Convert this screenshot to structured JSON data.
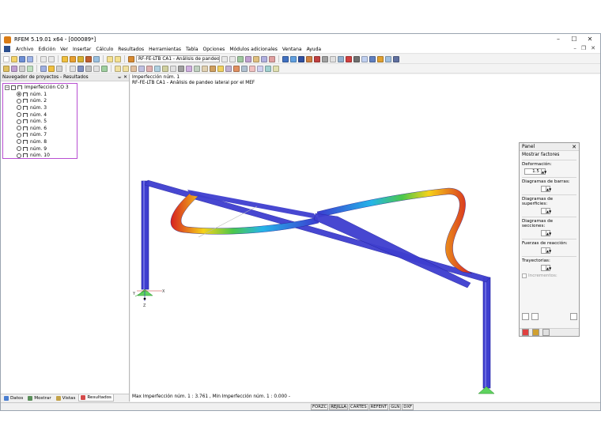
{
  "window": {
    "title": "RFEM 5.19.01 x64 - [000089*]"
  },
  "menu": [
    "Archivo",
    "Edición",
    "Ver",
    "Insertar",
    "Cálculo",
    "Resultados",
    "Herramientas",
    "Tabla",
    "Opciones",
    "Módulos adicionales",
    "Ventana",
    "Ayuda"
  ],
  "toolbar": {
    "case_combo": "RF-FE-LTB CA1 - Análisis de pandeo lat"
  },
  "navigator": {
    "title": "Navegador de proyectos - Resultados",
    "root": "Imperfección CO 3",
    "items": [
      {
        "label": "núm. 1",
        "selected": true
      },
      {
        "label": "núm. 2",
        "selected": false
      },
      {
        "label": "núm. 3",
        "selected": false
      },
      {
        "label": "núm. 4",
        "selected": false
      },
      {
        "label": "núm. 5",
        "selected": false
      },
      {
        "label": "núm. 6",
        "selected": false
      },
      {
        "label": "núm. 7",
        "selected": false
      },
      {
        "label": "núm. 8",
        "selected": false
      },
      {
        "label": "núm. 9",
        "selected": false
      },
      {
        "label": "núm. 10",
        "selected": false
      }
    ],
    "tabs": [
      "Datos",
      "Mostrar",
      "Vistas",
      "Resultados"
    ]
  },
  "viewport": {
    "line1": "Imperfección núm. 1",
    "line2": "RF-FE-LTB CA1 - Análisis de pandeo lateral por el MEF",
    "status": "Max Imperfección núm. 1 : 3.761 , Min Imperfección núm. 1 : 0.000 -",
    "axes": {
      "x": "X",
      "y": "Y",
      "z": "Z"
    }
  },
  "panel": {
    "title": "Panel",
    "subtitle": "Mostrar factores",
    "deformation_label": "Deformación:",
    "deformation_value": "1.5",
    "groups": [
      "Diagramas de barras:",
      "Diagramas de superficies:",
      "Diagramas de secciones:",
      "Fuerzas de reacción:",
      "Trayectorias:"
    ],
    "increments_label": "Incrementos:"
  },
  "statusbar": [
    "FORZC",
    "REJILLA",
    "CARTES",
    "REFENT",
    "GLN",
    "DXF"
  ],
  "colors": {
    "accent_purple": "#b84fd2",
    "beam_blue": "#3e3ecf",
    "support_green": "#5fd35f"
  }
}
